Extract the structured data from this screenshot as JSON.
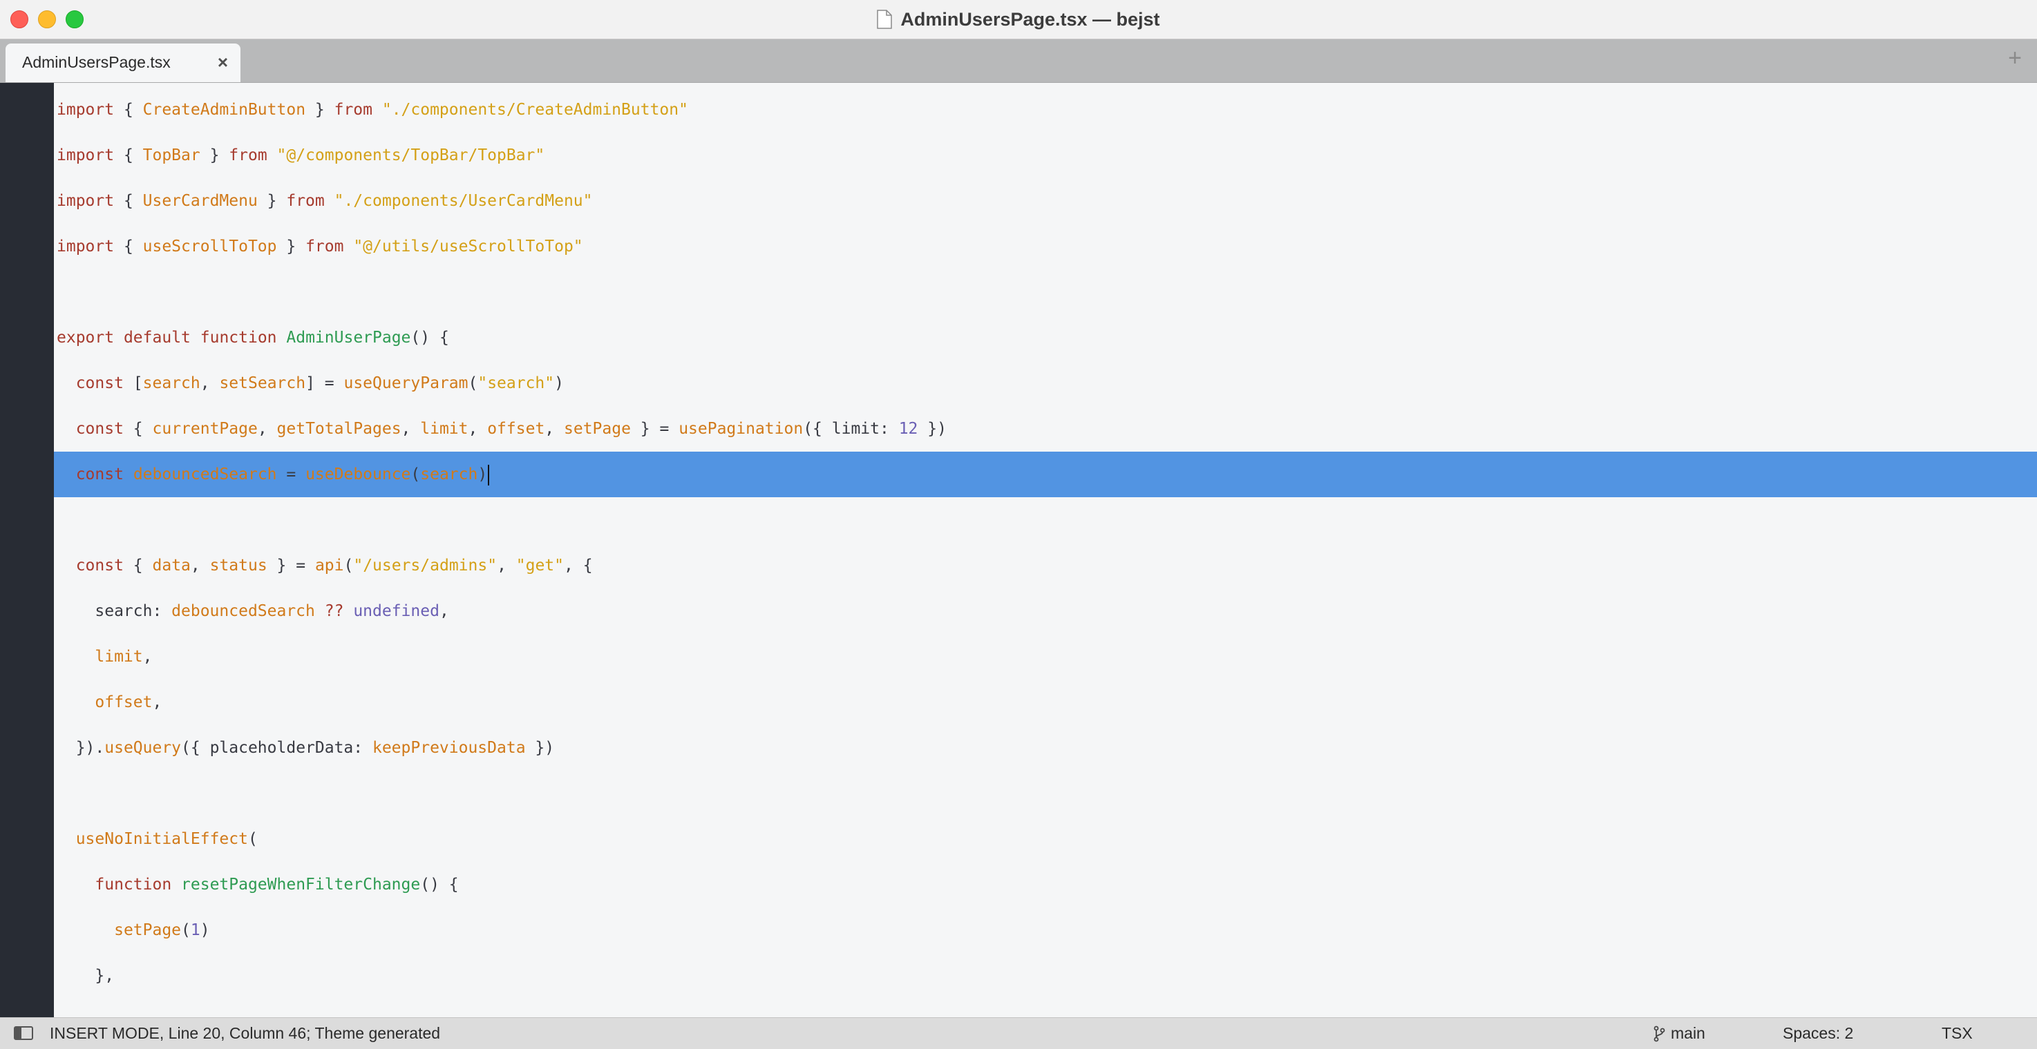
{
  "window": {
    "title": "AdminUsersPage.tsx — bejst"
  },
  "tabs": [
    {
      "label": "AdminUsersPage.tsx",
      "close_icon": "×"
    }
  ],
  "tabbar": {
    "new_tab_icon": "+"
  },
  "editor": {
    "lines": [
      [
        [
          "kw",
          "import"
        ],
        [
          "txt",
          " { "
        ],
        [
          "id",
          "CreateAdminButton"
        ],
        [
          "txt",
          " } "
        ],
        [
          "kw",
          "from"
        ],
        [
          "txt",
          " "
        ],
        [
          "str",
          "\"./components/CreateAdminButton\""
        ]
      ],
      [
        [
          "kw",
          "import"
        ],
        [
          "txt",
          " { "
        ],
        [
          "id",
          "TopBar"
        ],
        [
          "txt",
          " } "
        ],
        [
          "kw",
          "from"
        ],
        [
          "txt",
          " "
        ],
        [
          "str",
          "\"@/components/TopBar/TopBar\""
        ]
      ],
      [
        [
          "kw",
          "import"
        ],
        [
          "txt",
          " { "
        ],
        [
          "id",
          "UserCardMenu"
        ],
        [
          "txt",
          " } "
        ],
        [
          "kw",
          "from"
        ],
        [
          "txt",
          " "
        ],
        [
          "str",
          "\"./components/UserCardMenu\""
        ]
      ],
      [
        [
          "kw",
          "import"
        ],
        [
          "txt",
          " { "
        ],
        [
          "id",
          "useScrollToTop"
        ],
        [
          "txt",
          " } "
        ],
        [
          "kw",
          "from"
        ],
        [
          "txt",
          " "
        ],
        [
          "str",
          "\"@/utils/useScrollToTop\""
        ]
      ],
      [],
      [
        [
          "kw",
          "export"
        ],
        [
          "txt",
          " "
        ],
        [
          "kw",
          "default"
        ],
        [
          "txt",
          " "
        ],
        [
          "kw",
          "function"
        ],
        [
          "txt",
          " "
        ],
        [
          "fn",
          "AdminUserPage"
        ],
        [
          "txt",
          "() {"
        ]
      ],
      [
        [
          "txt",
          "  "
        ],
        [
          "kw",
          "const"
        ],
        [
          "txt",
          " ["
        ],
        [
          "id",
          "search"
        ],
        [
          "txt",
          ", "
        ],
        [
          "id",
          "setSearch"
        ],
        [
          "txt",
          "] = "
        ],
        [
          "id",
          "useQueryParam"
        ],
        [
          "txt",
          "("
        ],
        [
          "str",
          "\"search\""
        ],
        [
          "txt",
          ")"
        ]
      ],
      [
        [
          "txt",
          "  "
        ],
        [
          "kw",
          "const"
        ],
        [
          "txt",
          " { "
        ],
        [
          "id",
          "currentPage"
        ],
        [
          "txt",
          ", "
        ],
        [
          "id",
          "getTotalPages"
        ],
        [
          "txt",
          ", "
        ],
        [
          "id",
          "limit"
        ],
        [
          "txt",
          ", "
        ],
        [
          "id",
          "offset"
        ],
        [
          "txt",
          ", "
        ],
        [
          "id",
          "setPage"
        ],
        [
          "txt",
          " } = "
        ],
        [
          "id",
          "usePagination"
        ],
        [
          "txt",
          "({ limit: "
        ],
        [
          "num",
          "12"
        ],
        [
          "txt",
          " })"
        ]
      ],
      [
        [
          "txt",
          "  "
        ],
        [
          "kw",
          "const"
        ],
        [
          "txt",
          " "
        ],
        [
          "id",
          "debouncedSearch"
        ],
        [
          "txt",
          " = "
        ],
        [
          "id",
          "useDebounce"
        ],
        [
          "txt",
          "("
        ],
        [
          "id",
          "search"
        ],
        [
          "txt",
          ")"
        ]
      ],
      [],
      [
        [
          "txt",
          "  "
        ],
        [
          "kw",
          "const"
        ],
        [
          "txt",
          " { "
        ],
        [
          "id",
          "data"
        ],
        [
          "txt",
          ", "
        ],
        [
          "id",
          "status"
        ],
        [
          "txt",
          " } = "
        ],
        [
          "id",
          "api"
        ],
        [
          "txt",
          "("
        ],
        [
          "str",
          "\"/users/admins\""
        ],
        [
          "txt",
          ", "
        ],
        [
          "str",
          "\"get\""
        ],
        [
          "txt",
          ", {"
        ]
      ],
      [
        [
          "txt",
          "    search: "
        ],
        [
          "id",
          "debouncedSearch"
        ],
        [
          "txt",
          " "
        ],
        [
          "kw",
          "??"
        ],
        [
          "txt",
          " "
        ],
        [
          "und",
          "undefined"
        ],
        [
          "txt",
          ","
        ]
      ],
      [
        [
          "txt",
          "    "
        ],
        [
          "id",
          "limit"
        ],
        [
          "txt",
          ","
        ]
      ],
      [
        [
          "txt",
          "    "
        ],
        [
          "id",
          "offset"
        ],
        [
          "txt",
          ","
        ]
      ],
      [
        [
          "txt",
          "  })."
        ],
        [
          "id",
          "useQuery"
        ],
        [
          "txt",
          "({ placeholderData: "
        ],
        [
          "id",
          "keepPreviousData"
        ],
        [
          "txt",
          " })"
        ]
      ],
      [],
      [
        [
          "txt",
          "  "
        ],
        [
          "id",
          "useNoInitialEffect"
        ],
        [
          "txt",
          "("
        ]
      ],
      [
        [
          "txt",
          "    "
        ],
        [
          "kw",
          "function"
        ],
        [
          "txt",
          " "
        ],
        [
          "fn",
          "resetPageWhenFilterChange"
        ],
        [
          "txt",
          "() {"
        ]
      ],
      [
        [
          "txt",
          "      "
        ],
        [
          "id",
          "setPage"
        ],
        [
          "txt",
          "("
        ],
        [
          "num",
          "1"
        ],
        [
          "txt",
          ")"
        ]
      ],
      [
        [
          "txt",
          "    },"
        ]
      ]
    ],
    "selected_line_index": 8
  },
  "statusbar": {
    "mode_text": "INSERT MODE, Line 20, Column 46; Theme generated",
    "branch": "main",
    "indentation": "Spaces: 2",
    "syntax": "TSX"
  },
  "colors": {
    "keyword": "#a63b2e",
    "function": "#2e9b52",
    "identifier": "#d17a1a",
    "string": "#d4a017",
    "number": "#6a5fb4",
    "selection": "#5294e2"
  },
  "icons": {
    "document": "document-icon",
    "close": "close-icon",
    "add_tab": "plus-icon",
    "sidebar_toggle": "sidebar-toggle-icon",
    "branch": "git-branch-icon"
  }
}
